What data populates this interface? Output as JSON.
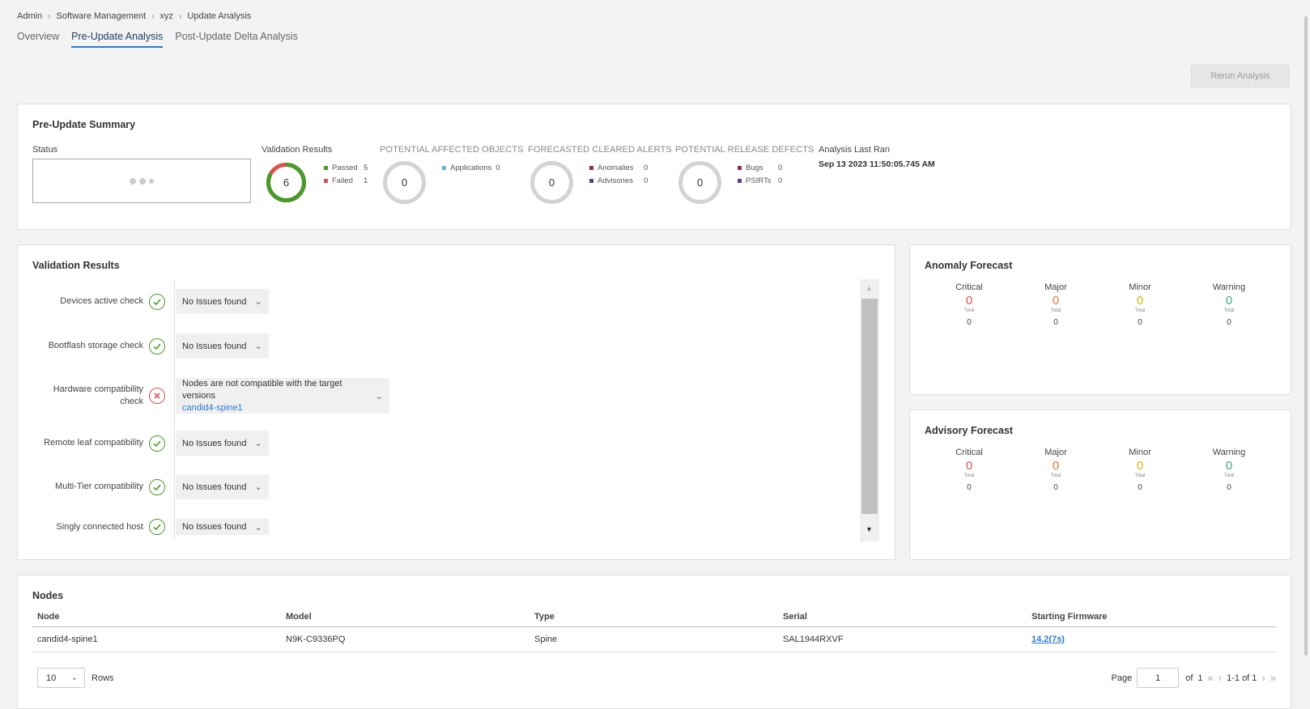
{
  "breadcrumb": [
    "Admin",
    "Software Management",
    "xyz",
    "Update Analysis"
  ],
  "tabs": [
    {
      "label": "Overview",
      "active": false
    },
    {
      "label": "Pre-Update Analysis",
      "active": true
    },
    {
      "label": "Post-Update Delta Analysis",
      "active": false
    }
  ],
  "rerun_label": "Rerun Analysis",
  "summary": {
    "title": "Pre-Update Summary",
    "status_label": "Status",
    "validation": {
      "label": "Validation Results",
      "total": "6",
      "passed_label": "Passed",
      "passed": "5",
      "failed_label": "Failed",
      "failed": "1",
      "passed_fraction": 0.833
    },
    "affected": {
      "label": "POTENTIAL AFFECTED OBJECTS",
      "total": "0",
      "items": [
        {
          "name": "Applications",
          "value": "0"
        }
      ]
    },
    "cleared": {
      "label": "FORECASTED CLEARED ALERTS",
      "total": "0",
      "items": [
        {
          "name": "Anomalies",
          "value": "0"
        },
        {
          "name": "Advisories",
          "value": "0"
        }
      ]
    },
    "defects": {
      "label": "POTENTIAL RELEASE DEFECTS",
      "total": "0",
      "items": [
        {
          "name": "Bugs",
          "value": "0"
        },
        {
          "name": "PSIRTs",
          "value": "0"
        }
      ]
    },
    "last_ran_label": "Analysis Last Ran",
    "last_ran": "Sep 13 2023 11:50:05.745 AM"
  },
  "validation_panel": {
    "title": "Validation Results",
    "checks": [
      {
        "label": "Devices active check",
        "status": "pass",
        "result": "No Issues found"
      },
      {
        "label": "Bootflash storage check",
        "status": "pass",
        "result": "No Issues found"
      },
      {
        "label": "Hardware compatibility check",
        "status": "fail",
        "result": "Nodes are not compatible with the target versions",
        "link": "candid4-spine1"
      },
      {
        "label": "Remote leaf compatibility",
        "status": "pass",
        "result": "No Issues found"
      },
      {
        "label": "Multi-Tier compatibility",
        "status": "pass",
        "result": "No Issues found"
      },
      {
        "label": "Singly connected host",
        "status": "pass",
        "result": "No Issues found"
      }
    ]
  },
  "anomaly_forecast": {
    "title": "Anomaly Forecast",
    "columns": [
      {
        "name": "Critical",
        "value": "0",
        "total_label": "Total",
        "total": "0"
      },
      {
        "name": "Major",
        "value": "0",
        "total_label": "Total",
        "total": "0"
      },
      {
        "name": "Minor",
        "value": "0",
        "total_label": "Total",
        "total": "0"
      },
      {
        "name": "Warning",
        "value": "0",
        "total_label": "Total",
        "total": "0"
      }
    ]
  },
  "advisory_forecast": {
    "title": "Advisory Forecast",
    "columns": [
      {
        "name": "Critical",
        "value": "0",
        "total_label": "Total",
        "total": "0"
      },
      {
        "name": "Major",
        "value": "0",
        "total_label": "Total",
        "total": "0"
      },
      {
        "name": "Minor",
        "value": "0",
        "total_label": "Total",
        "total": "0"
      },
      {
        "name": "Warning",
        "value": "0",
        "total_label": "Total",
        "total": "0"
      }
    ]
  },
  "colors": {
    "critical": "#d9534f",
    "major": "#e07b39",
    "minor": "#d6b400",
    "warning": "#3aa981",
    "pass": "#4a9a2a",
    "fail": "#d9534f"
  },
  "nodes": {
    "title": "Nodes",
    "headers": [
      "Node",
      "Model",
      "Type",
      "Serial",
      "Starting Firmware"
    ],
    "rows": [
      {
        "node": "candid4-spine1",
        "model": "N9K-C9336PQ",
        "type": "Spine",
        "serial": "SAL1944RXVF",
        "firmware": "14.2(7s)"
      }
    ],
    "rows_per_page": "10",
    "rows_label": "Rows",
    "page_label": "Page",
    "page": "1",
    "of_label": "of",
    "total_pages": "1",
    "range": "1-1 of 1"
  }
}
